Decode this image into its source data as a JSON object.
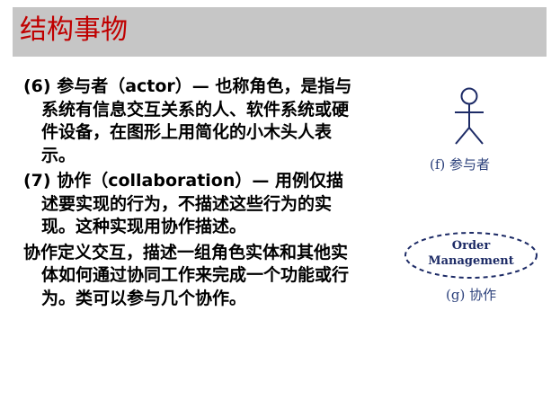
{
  "slide": {
    "title": "结构事物",
    "paragraphs": [
      "(6) 参与者（actor）— 也称角色，是指与系统有信息交互关系的人、软件系统或硬件设备，在图形上用简化的小木头人表示。",
      "(7) 协作（collaboration）— 用例仅描述要实现的行为，不描述这些行为的实现。这种实现用协作描述。",
      "协作定义交互，描述一组角色实体和其他实体如何通过协同工作来完成一个功能或行为。类可以参与几个协作。"
    ]
  },
  "figures": {
    "actor_caption": "(f) 参与者",
    "collaboration_line1": "Order",
    "collaboration_line2": "Management",
    "collaboration_caption": "(g) 协作",
    "colors": {
      "title": "#c00000",
      "title_bar": "#c6c6c6",
      "figure_stroke": "#1d2b66",
      "caption": "#2a3f7a"
    }
  }
}
